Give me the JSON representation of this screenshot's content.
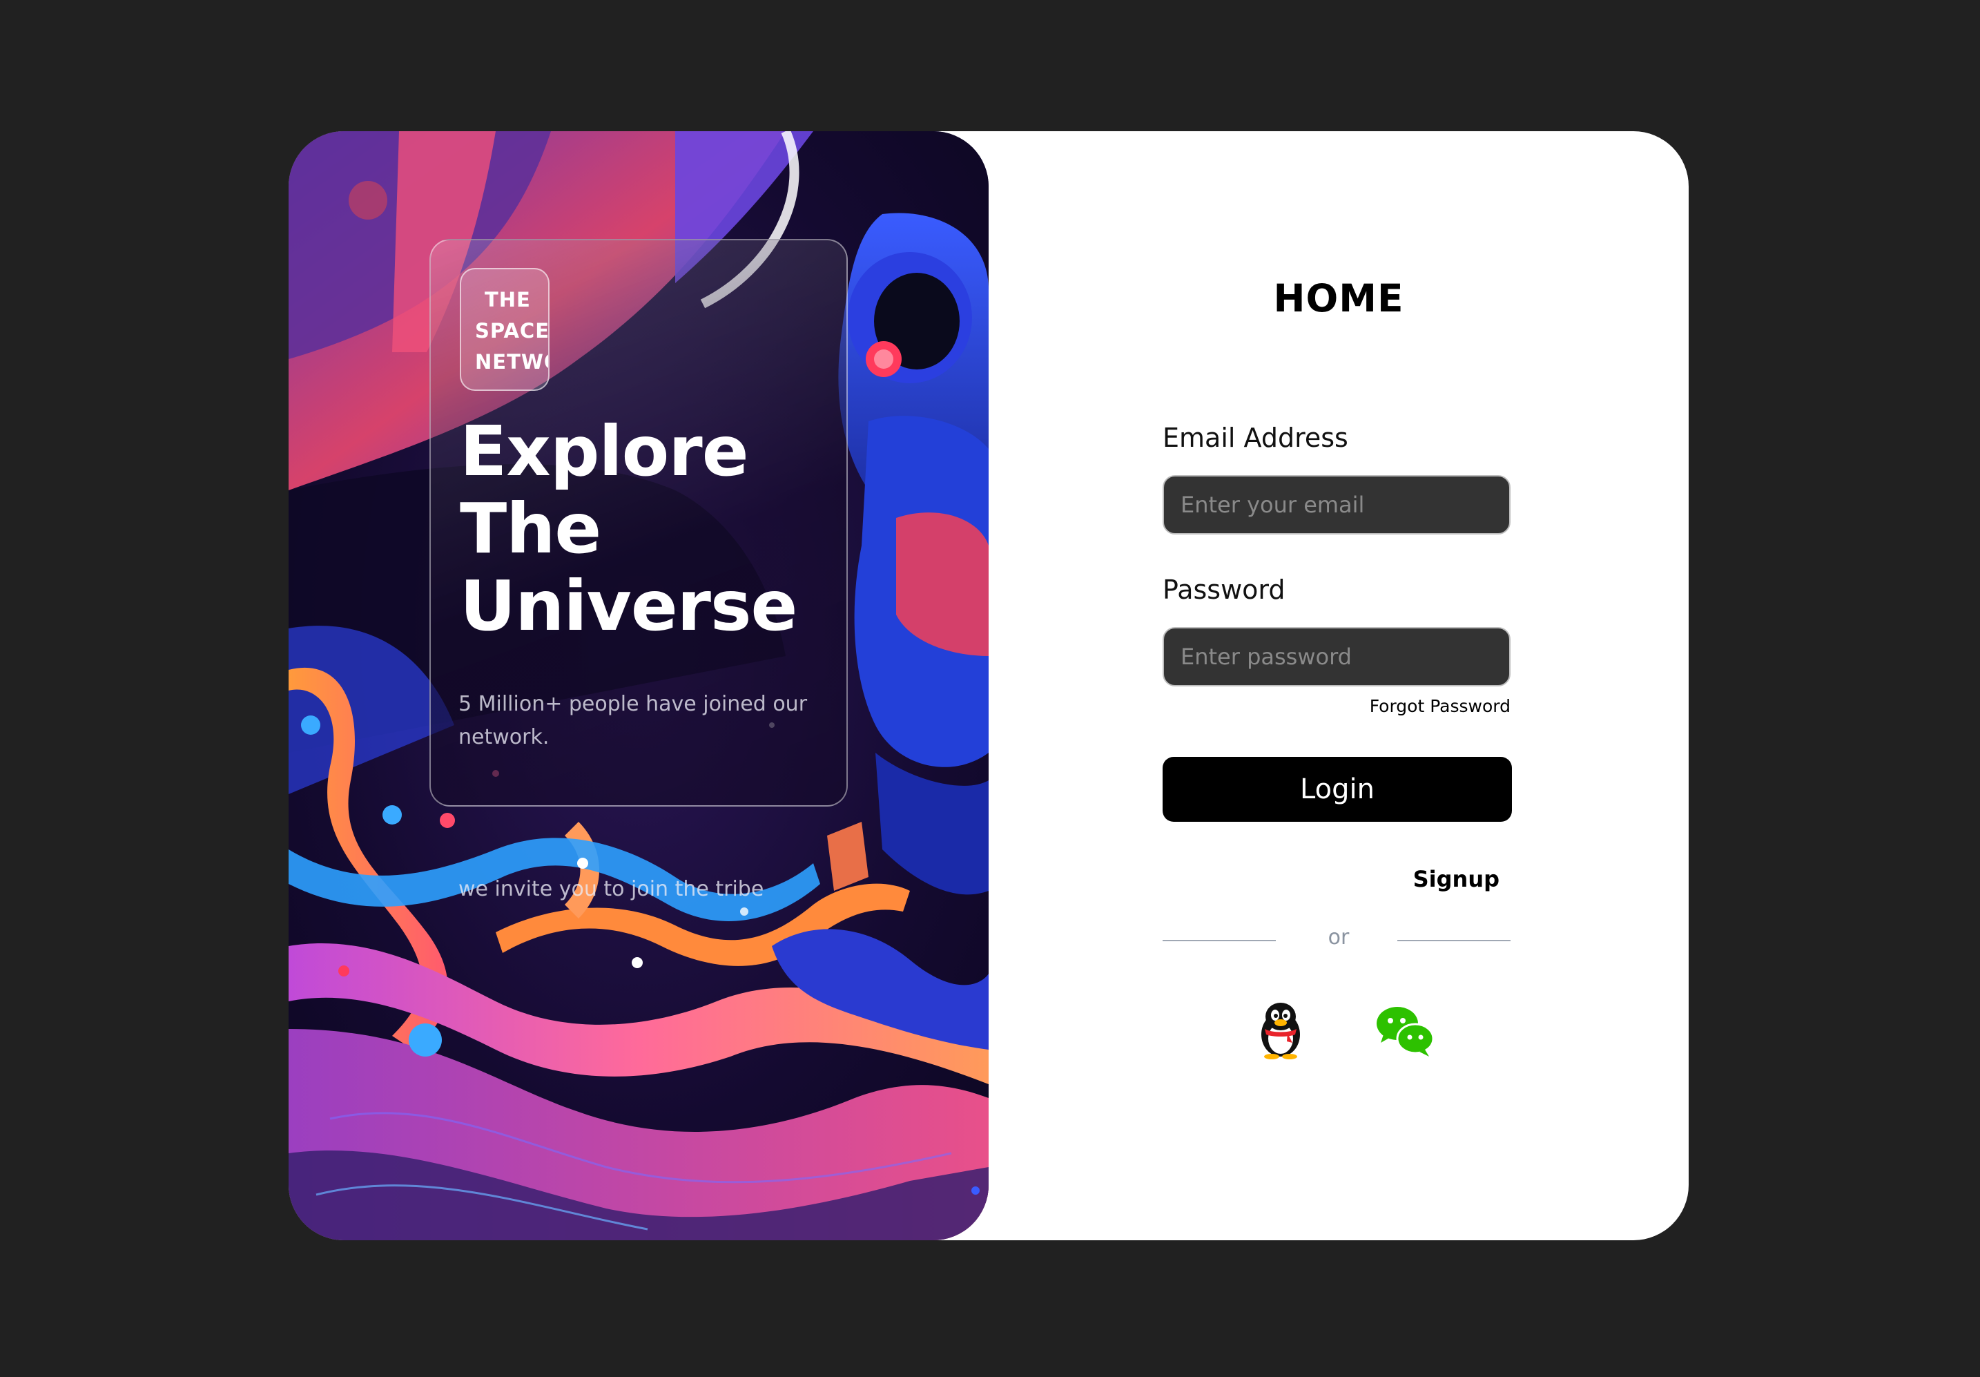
{
  "hero": {
    "badge_lines": [
      "THE",
      "SPACE",
      "NETWO"
    ],
    "headline_lines": [
      "Explore",
      "The",
      "Universe"
    ],
    "subtitle_1": "5 Million+ people have joined our network.",
    "subtitle_2": "we invite you to join the tribe"
  },
  "form": {
    "title": "HOME",
    "email_label": "Email Address",
    "email_placeholder": "Enter your email",
    "email_value": "",
    "password_label": "Password",
    "password_placeholder": "Enter password",
    "password_value": "",
    "forgot_label": "Forgot Password",
    "login_label": "Login",
    "signup_label": "Signup",
    "divider_text": "or"
  },
  "social": {
    "qq_icon": "qq-penguin-icon",
    "wechat_icon": "wechat-icon"
  },
  "colors": {
    "page_background": "#212121",
    "card_background": "#ffffff",
    "input_background": "#333333",
    "button_background": "#000000",
    "wechat_green": "#2dc100"
  }
}
